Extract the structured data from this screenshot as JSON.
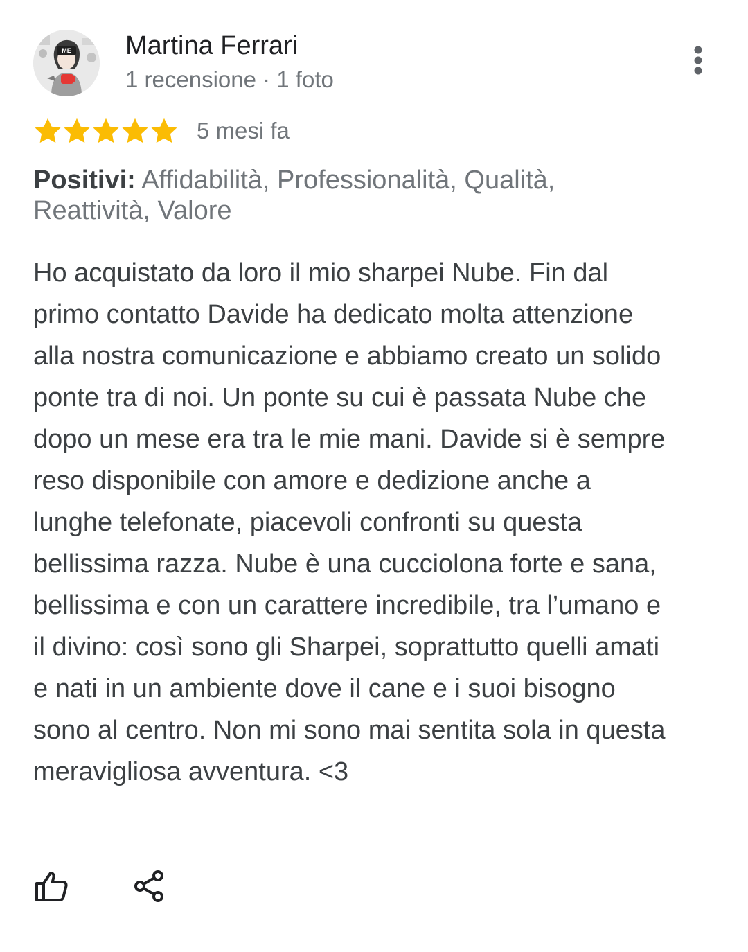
{
  "review": {
    "author": {
      "name": "Martina Ferrari",
      "meta": "1 recensione · 1 foto",
      "avatar_icon": "user-avatar-icon",
      "avatar_badge": "ME"
    },
    "menu_icon": "more-vert-icon",
    "rating": {
      "stars": 5,
      "max_stars": 5,
      "star_color": "#fbbc04",
      "time_ago": "5 mesi fa"
    },
    "attributes": {
      "label": "Positivi:",
      "values": "Affidabilità, Professionalità, Qualità, Reattività, Valore"
    },
    "text": "Ho acquistato da loro il mio sharpei Nube. Fin dal primo contatto Davide ha dedicato molta attenzione alla nostra comunicazione e abbiamo creato un solido ponte tra di noi. Un ponte su cui è passata Nube che dopo un mese era tra le mie mani. Davide si è sempre reso disponibile con amore e dedizione anche a lunghe telefonate, piacevoli confronti su questa bellissima razza. Nube è una cucciolona forte e sana, bellissima e con un carattere incredibile, tra l’umano e il divino: così sono gli Sharpei, soprattutto quelli amati e nati in un ambiente dove il cane e i suoi bisogno sono al centro. Non mi sono mai sentita sola in questa meravigliosa avventura. <3",
    "actions": {
      "like_icon": "thumb-up-icon",
      "share_icon": "share-icon"
    }
  }
}
